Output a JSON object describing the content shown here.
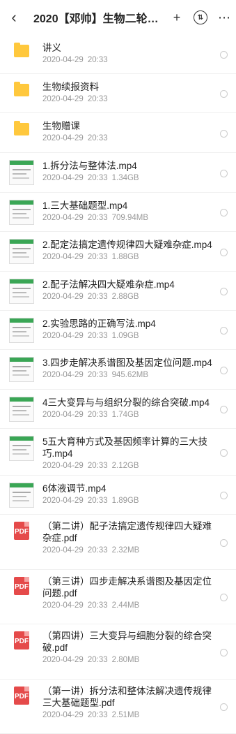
{
  "header": {
    "title": "2020【邓帅】生物二轮…",
    "back_icon": "‹",
    "add_icon": "+",
    "sort_icon": "⇅",
    "more_icon": "⋯"
  },
  "files": [
    {
      "type": "folder",
      "name": "讲义",
      "date": "2020-04-29",
      "time": "20:33",
      "size": ""
    },
    {
      "type": "folder",
      "name": "生物续报资料",
      "date": "2020-04-29",
      "time": "20:33",
      "size": ""
    },
    {
      "type": "folder",
      "name": "生物赠课",
      "date": "2020-04-29",
      "time": "20:33",
      "size": ""
    },
    {
      "type": "video",
      "name": "1.拆分法与整体法.mp4",
      "date": "2020-04-29",
      "time": "20:33",
      "size": "1.34GB"
    },
    {
      "type": "video",
      "name": "1.三大基础题型.mp4",
      "date": "2020-04-29",
      "time": "20:33",
      "size": "709.94MB"
    },
    {
      "type": "video",
      "name": "2.配定法搞定遗传规律四大疑难杂症.mp4",
      "date": "2020-04-29",
      "time": "20:33",
      "size": "1.88GB"
    },
    {
      "type": "video",
      "name": "2.配子法解决四大疑难杂症.mp4",
      "date": "2020-04-29",
      "time": "20:33",
      "size": "2.88GB"
    },
    {
      "type": "video",
      "name": "2.实验思路的正确写法.mp4",
      "date": "2020-04-29",
      "time": "20:33",
      "size": "1.09GB"
    },
    {
      "type": "video",
      "name": "3.四步走解决系谱图及基因定位问题.mp4",
      "date": "2020-04-29",
      "time": "20:33",
      "size": "945.62MB"
    },
    {
      "type": "video",
      "name": "4三大变异与与组织分裂的综合突破.mp4",
      "date": "2020-04-29",
      "time": "20:33",
      "size": "1.74GB"
    },
    {
      "type": "video",
      "name": "5五大育种方式及基因频率计算的三大技巧.mp4",
      "date": "2020-04-29",
      "time": "20:33",
      "size": "2.12GB"
    },
    {
      "type": "video",
      "name": "6体液调节.mp4",
      "date": "2020-04-29",
      "time": "20:33",
      "size": "1.89GB"
    },
    {
      "type": "pdf",
      "name": "（第二讲）配子法搞定遗传规律四大疑难杂症.pdf",
      "date": "2020-04-29",
      "time": "20:33",
      "size": "2.32MB"
    },
    {
      "type": "pdf",
      "name": "（第三讲）四步走解决系谱图及基因定位问题.pdf",
      "date": "2020-04-29",
      "time": "20:33",
      "size": "2.44MB"
    },
    {
      "type": "pdf",
      "name": "（第四讲）三大变异与细胞分裂的综合突破.pdf",
      "date": "2020-04-29",
      "time": "20:33",
      "size": "2.80MB"
    },
    {
      "type": "pdf",
      "name": "（第一讲）拆分法和整体法解决遗传规律三大基础题型.pdf",
      "date": "2020-04-29",
      "time": "20:33",
      "size": "2.51MB"
    }
  ],
  "colors": {
    "folder": "#ffc83d",
    "pdf": "#e54a4a",
    "video_band": "#3aa655"
  },
  "icons": {
    "pdf_label": "PDF"
  }
}
